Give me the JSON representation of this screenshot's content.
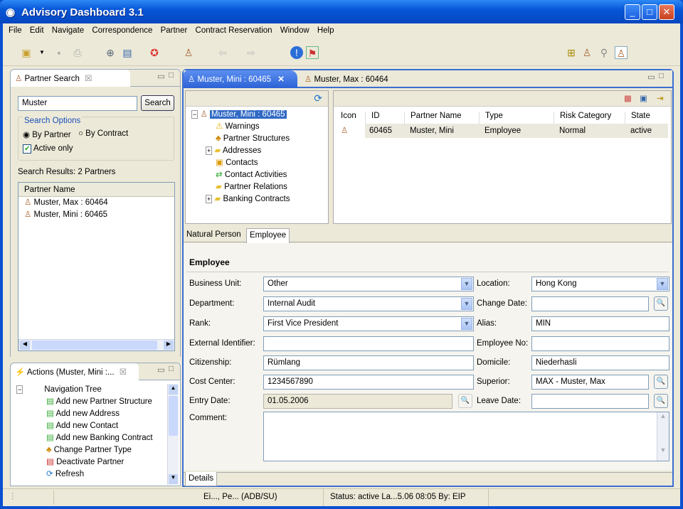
{
  "window": {
    "title": "Advisory Dashboard 3.1",
    "minimize": "_",
    "maximize": "□",
    "close": "✕"
  },
  "menu": [
    "File",
    "Edit",
    "Navigate",
    "Correspondence",
    "Partner",
    "Contract Reservation",
    "Window",
    "Help"
  ],
  "search_view": {
    "tab": "Partner Search",
    "search_value": "Muster",
    "search_button": "Search",
    "options_title": "Search Options",
    "by_partner": "By Partner",
    "by_contract": "By Contract",
    "active_only": "Active only",
    "results": "Search Results:  2 Partners",
    "column": "Partner Name",
    "items": [
      "Muster, Max : 60464",
      "Muster, Mini : 60465"
    ]
  },
  "actions_view": {
    "tab": "Actions (Muster, Mini :...",
    "items": [
      "Navigation Tree",
      "Add new Partner Structure",
      "Add new Address",
      "Add new Contact",
      "Add new Banking Contract",
      "Change Partner Type",
      "Deactivate Partner",
      "Refresh"
    ]
  },
  "editor": {
    "tabs": [
      "Muster, Mini : 60465",
      "Muster, Max : 60464"
    ],
    "tree": [
      "Muster, Mini : 60465",
      "Warnings",
      "Partner Structures",
      "Addresses",
      "Contacts",
      "Contact Activities",
      "Partner Relations",
      "Banking Contracts"
    ],
    "table": {
      "columns": [
        "Icon",
        "ID",
        "Partner Name",
        "Type",
        "Risk Category",
        "State"
      ],
      "rows": [
        [
          "60465",
          "Muster, Mini",
          "Employee",
          "Normal",
          "active"
        ]
      ]
    },
    "subtabs": [
      "Natural Person",
      "Employee"
    ],
    "section": "Employee",
    "fields": {
      "business_unit_l": "Business Unit:",
      "business_unit": "Other",
      "location_l": "Location:",
      "location": "Hong Kong",
      "department_l": "Department:",
      "department": "Internal Audit",
      "change_date_l": "Change Date:",
      "change_date": "",
      "rank_l": "Rank:",
      "rank": "First Vice President",
      "alias_l": "Alias:",
      "alias": "MIN",
      "ext_id_l": "External Identifier:",
      "ext_id": "",
      "emp_no_l": "Employee No:",
      "emp_no": "",
      "citizenship_l": "Citizenship:",
      "citizenship": "Rümlang",
      "domicile_l": "Domicile:",
      "domicile": "Niederhasli",
      "cost_center_l": "Cost Center:",
      "cost_center": "1234567890",
      "superior_l": "Superior:",
      "superior": "MAX - Muster, Max",
      "entry_date_l": "Entry Date:",
      "entry_date": "01.05.2006",
      "leave_date_l": "Leave Date:",
      "leave_date": "",
      "comment_l": "Comment:",
      "comment": ""
    },
    "bottom_tab": "Details"
  },
  "status": {
    "user": "Ei..., Pe... (ADB/SU)",
    "info": "Status: active  La...5.06 08:05 By: EIP"
  }
}
